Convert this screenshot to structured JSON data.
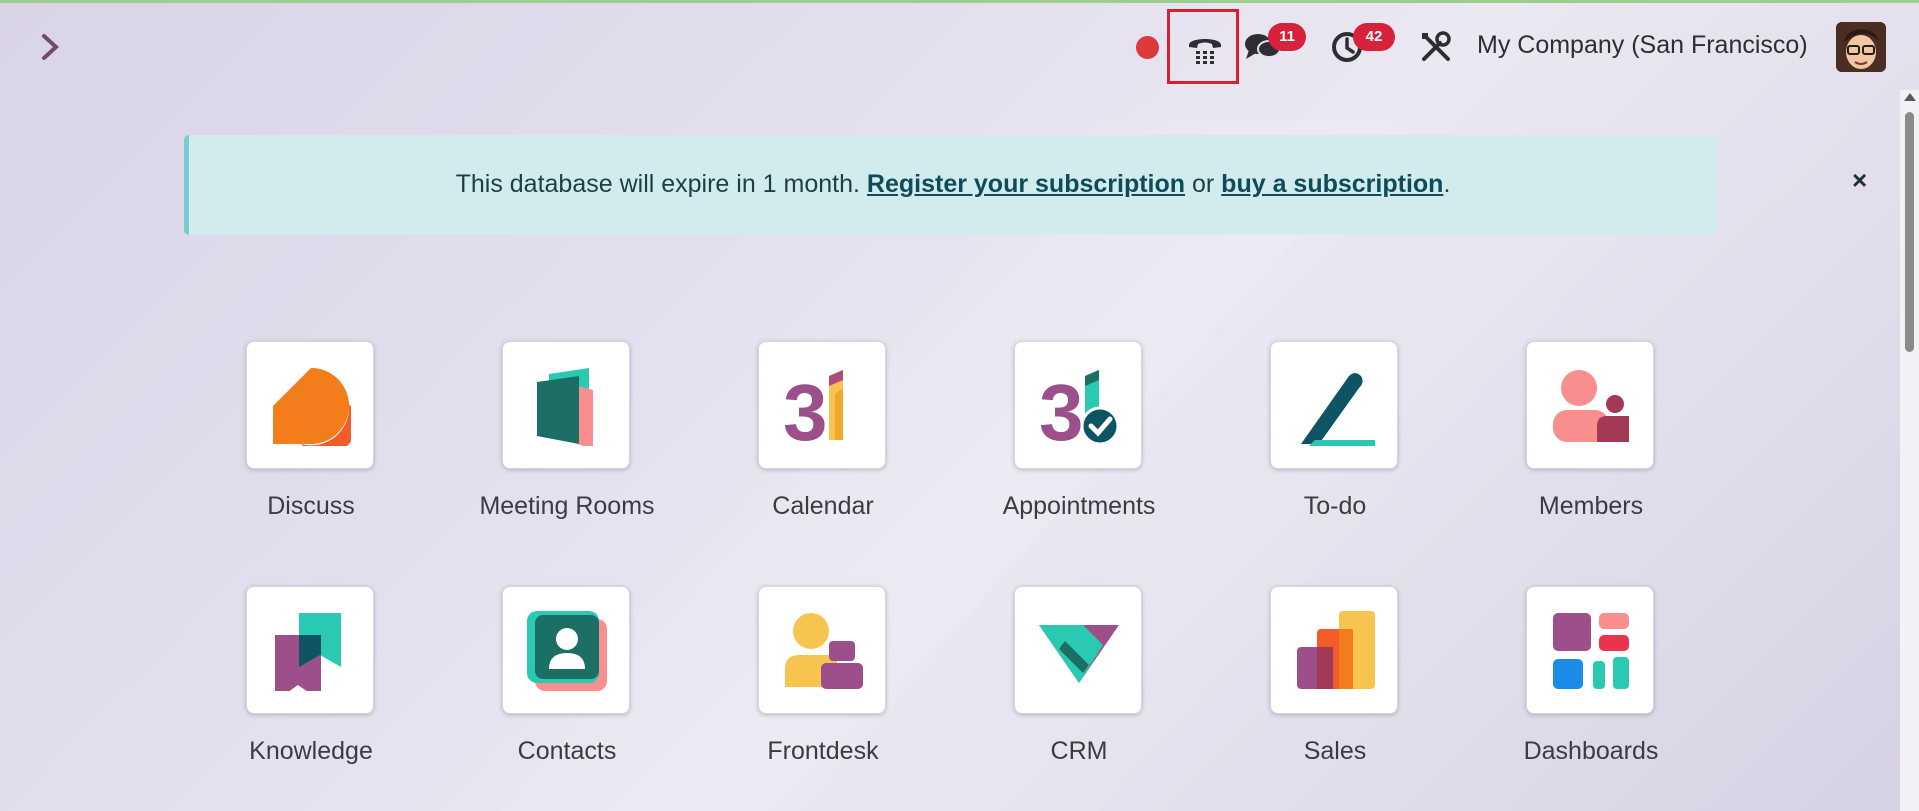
{
  "header": {
    "company": "My Company (San Francisco)",
    "messages_count": "11",
    "activities_count": "42",
    "icons": [
      "menu-toggle-icon",
      "recording-dot-icon",
      "phone-dialpad-icon",
      "chat-bubbles-icon",
      "clock-icon",
      "tools-icon",
      "user-avatar"
    ]
  },
  "alert": {
    "text_before": "This database will expire in 1 month. ",
    "register_link": "Register your subscription",
    "text_middle": " or ",
    "buy_link": "buy a subscription",
    "text_after": ".",
    "close": "×"
  },
  "apps": [
    {
      "label": "Discuss"
    },
    {
      "label": "Meeting Rooms"
    },
    {
      "label": "Calendar"
    },
    {
      "label": "Appointments"
    },
    {
      "label": "To-do"
    },
    {
      "label": "Members"
    },
    {
      "label": "Knowledge"
    },
    {
      "label": "Contacts"
    },
    {
      "label": "Frontdesk"
    },
    {
      "label": "CRM"
    },
    {
      "label": "Sales"
    },
    {
      "label": "Dashboards"
    }
  ],
  "colors": {
    "brand": "#714b67",
    "badge": "#d6223a",
    "alert_bg": "#d2ecee",
    "highlight_border": "#d6222e"
  }
}
